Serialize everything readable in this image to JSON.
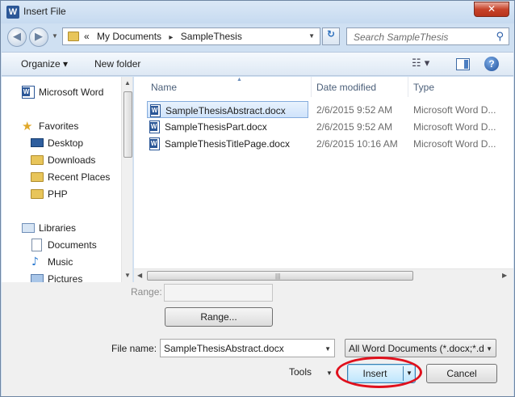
{
  "window": {
    "title": "Insert File",
    "app_icon_letter": "W",
    "close_glyph": "✕"
  },
  "nav": {
    "back_glyph": "◀",
    "forward_glyph": "▶",
    "breadcrumb_prefix": "«",
    "breadcrumb": [
      "My Documents",
      "SampleThesis"
    ],
    "breadcrumb_separator": "▸",
    "search_placeholder": "Search SampleThesis",
    "refresh_glyph": "↻"
  },
  "toolbar": {
    "organize": "Organize ▾",
    "new_folder": "New folder",
    "views_glyph": "☷ ▾",
    "help_glyph": "?"
  },
  "sidebar": {
    "items": [
      {
        "label": "Microsoft Word",
        "icon": "word-icon"
      },
      {
        "label": "Favorites",
        "icon": "star-icon"
      },
      {
        "label": "Desktop",
        "icon": "desktop-icon"
      },
      {
        "label": "Downloads",
        "icon": "downloads-icon"
      },
      {
        "label": "Recent Places",
        "icon": "recent-places-icon"
      },
      {
        "label": "PHP",
        "icon": "folder-icon"
      },
      {
        "label": "Libraries",
        "icon": "libraries-icon"
      },
      {
        "label": "Documents",
        "icon": "documents-icon"
      },
      {
        "label": "Music",
        "icon": "music-icon"
      },
      {
        "label": "Pictures",
        "icon": "pictures-icon"
      }
    ]
  },
  "filelist": {
    "columns": {
      "name": "Name",
      "date": "Date modified",
      "type": "Type"
    },
    "rows": [
      {
        "name": "SampleThesisAbstract.docx",
        "date": "2/6/2015 9:52 AM",
        "type": "Microsoft Word D..."
      },
      {
        "name": "SampleThesisPart.docx",
        "date": "2/6/2015 9:52 AM",
        "type": "Microsoft Word D..."
      },
      {
        "name": "SampleThesisTitlePage.docx",
        "date": "2/6/2015 10:16 AM",
        "type": "Microsoft Word D..."
      }
    ]
  },
  "bottom": {
    "range_label": "Range:",
    "range_button": "Range...",
    "file_name_label": "File name:",
    "file_name_value": "SampleThesisAbstract.docx",
    "filter_value": "All Word Documents (*.docx;*.d",
    "tools_label": "Tools",
    "insert_label": "Insert",
    "cancel_label": "Cancel"
  },
  "colors": {
    "highlight_ring": "#e0101c",
    "selection": "#cfe3fb"
  }
}
